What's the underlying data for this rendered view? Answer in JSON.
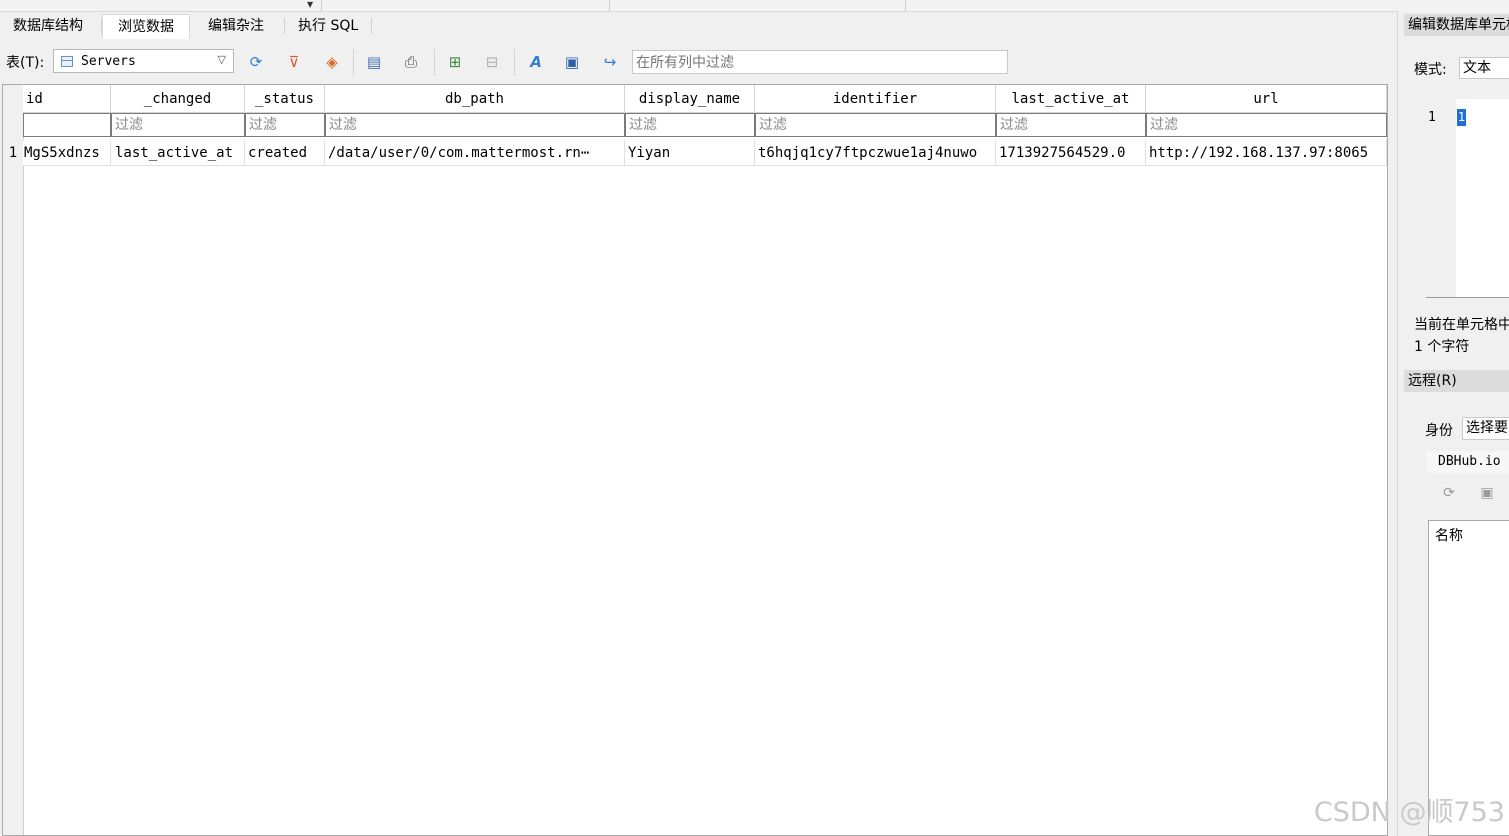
{
  "tabs": [
    {
      "label": "数据库结构"
    },
    {
      "label": "浏览数据"
    },
    {
      "label": "编辑杂注"
    },
    {
      "label": "执行 SQL"
    }
  ],
  "toolbar": {
    "table_label": "表(T):",
    "table_value": "Servers",
    "filter_placeholder": "在所有列中过滤",
    "icons": [
      "refresh-icon",
      "clear-filters-icon",
      "save-filter-icon",
      "export-icon",
      "print-icon",
      "insert-record-icon",
      "delete-record-icon",
      "find-icon",
      "find-replace-icon",
      "goto-icon"
    ]
  },
  "grid": {
    "columns": [
      "id",
      "_changed",
      "_status",
      "db_path",
      "display_name",
      "identifier",
      "last_active_at",
      "url"
    ],
    "filter_placeholder": "过滤",
    "rows": [
      {
        "num": "1",
        "cells": [
          "MgS5xdnzs",
          "last_active_at",
          "created",
          "/data/user/0/com.mattermost.rn⋯",
          "Yiyan",
          "t6hqjq1cy7ftpczwue1aj4nuwo",
          "1713927564529.0",
          "http://192.168.137.97:8065"
        ]
      }
    ]
  },
  "right_pane": {
    "title": "编辑数据库单元格",
    "mode_label": "模式:",
    "mode_value": "文本",
    "editor_line_no": "1",
    "editor_text": "1",
    "cell_info_line1": "当前在单元格中",
    "cell_info_line2": "1  个字符",
    "remote_title": "远程(R)",
    "identity_label": "身份",
    "identity_value": "选择要",
    "dbhub_label": "DBHub.io",
    "list_header": "名称"
  },
  "watermark": "CSDN @顺753"
}
